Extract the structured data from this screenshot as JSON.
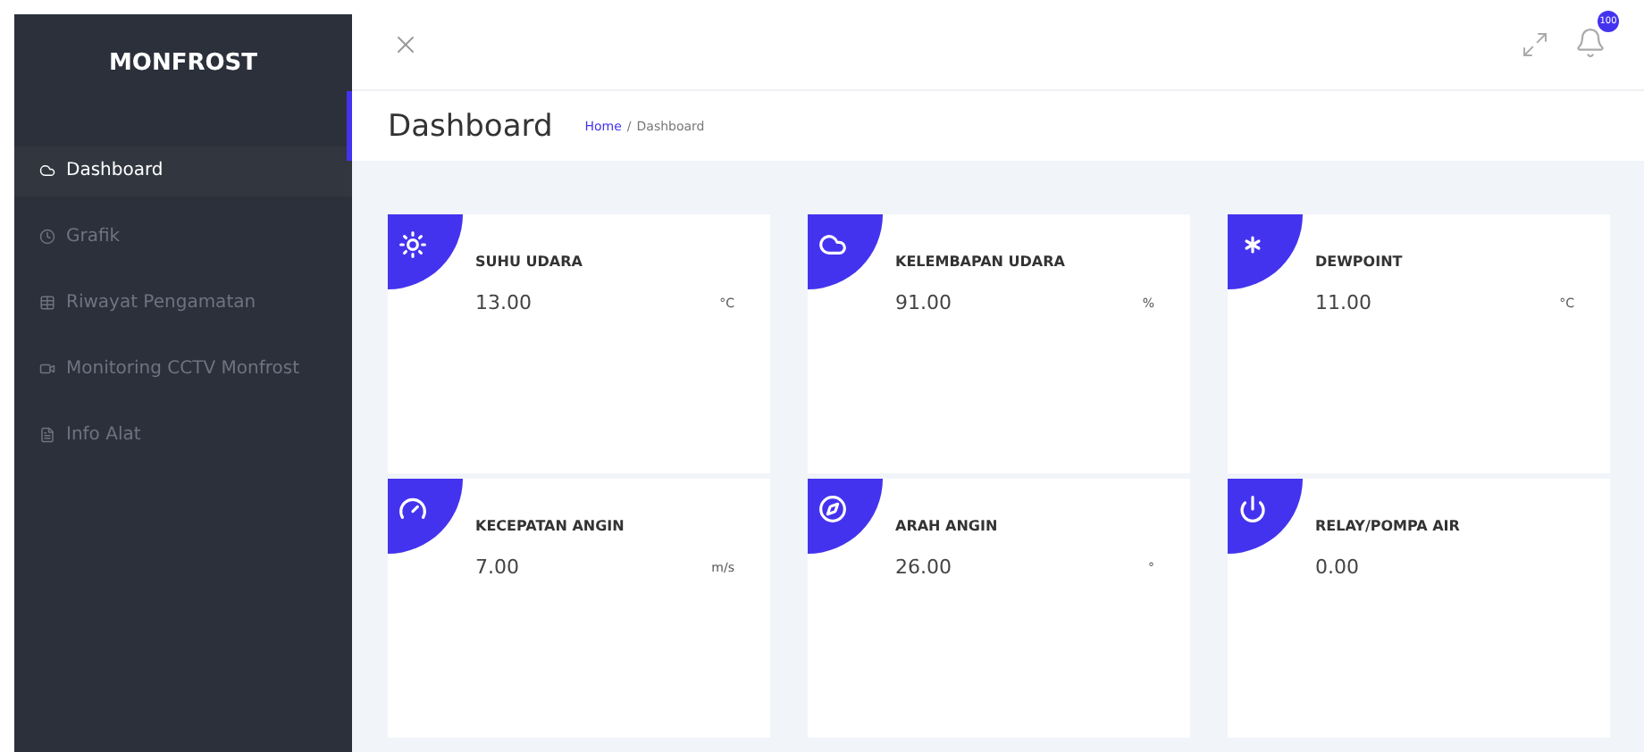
{
  "brand": "MONFROST",
  "sidebar": {
    "items": [
      {
        "label": "Dashboard",
        "selected": true
      },
      {
        "label": "Grafik",
        "selected": false
      },
      {
        "label": "Riwayat Pengamatan",
        "selected": false
      },
      {
        "label": "Monitoring CCTV Monfrost",
        "selected": false
      },
      {
        "label": "Info Alat",
        "selected": false
      }
    ]
  },
  "header": {
    "notification_count": "100"
  },
  "page": {
    "title": "Dashboard",
    "breadcrumb": {
      "home": "Home",
      "separator": "/",
      "current": "Dashboard"
    }
  },
  "cards": [
    {
      "title": "SUHU UDARA",
      "value": "13.00",
      "unit": "°C"
    },
    {
      "title": "KELEMBAPAN UDARA",
      "value": "91.00",
      "unit": "%"
    },
    {
      "title": "DEWPOINT",
      "value": "11.00",
      "unit": "°C"
    },
    {
      "title": "KECEPATAN ANGIN",
      "value": "7.00",
      "unit": "m/s"
    },
    {
      "title": "ARAH ANGIN",
      "value": "26.00",
      "unit": "°"
    },
    {
      "title": "RELAY/POMPA AIR",
      "value": "0.00"
    }
  ]
}
